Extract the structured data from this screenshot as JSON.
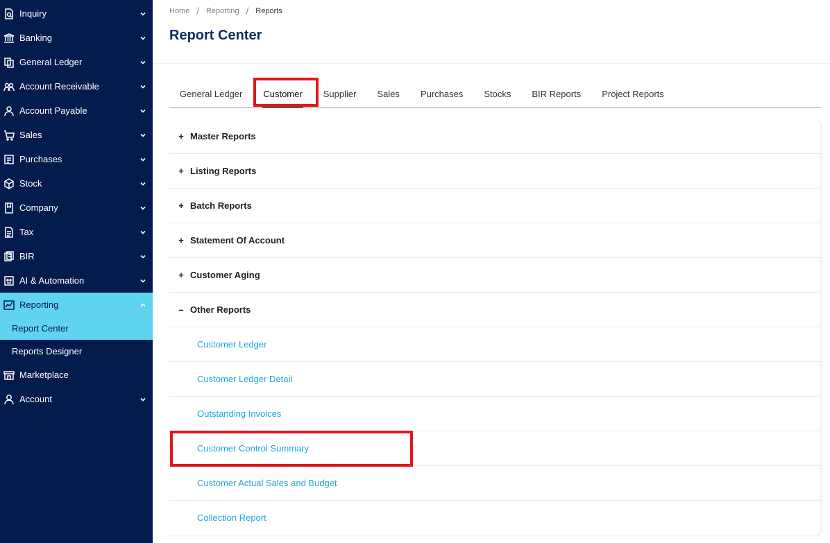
{
  "sidebar": {
    "items": [
      {
        "label": "Inquiry",
        "icon": "inquiry-icon"
      },
      {
        "label": "Banking",
        "icon": "bank-icon"
      },
      {
        "label": "General Ledger",
        "icon": "ledger-icon"
      },
      {
        "label": "Account Receivable",
        "icon": "receivable-icon"
      },
      {
        "label": "Account Payable",
        "icon": "payable-icon"
      },
      {
        "label": "Sales",
        "icon": "sales-icon"
      },
      {
        "label": "Purchases",
        "icon": "purchases-icon"
      },
      {
        "label": "Stock",
        "icon": "stock-icon"
      },
      {
        "label": "Company",
        "icon": "company-icon"
      },
      {
        "label": "Tax",
        "icon": "tax-icon"
      },
      {
        "label": "BIR",
        "icon": "bir-icon"
      },
      {
        "label": "AI & Automation",
        "icon": "ai-icon"
      },
      {
        "label": "Reporting",
        "icon": "reporting-icon"
      }
    ],
    "reporting_sub": [
      {
        "label": "Report Center"
      },
      {
        "label": "Reports Designer"
      }
    ],
    "after": [
      {
        "label": "Marketplace",
        "icon": "marketplace-icon"
      },
      {
        "label": "Account",
        "icon": "account-icon"
      }
    ]
  },
  "breadcrumb": [
    "Home",
    "Reporting",
    "Reports"
  ],
  "page_title": "Report Center",
  "tabs": [
    "General Ledger",
    "Customer",
    "Supplier",
    "Sales",
    "Purchases",
    "Stocks",
    "BIR Reports",
    "Project Reports"
  ],
  "active_tab": "Customer",
  "sections": [
    {
      "title": "Master Reports",
      "toggle": "+"
    },
    {
      "title": "Listing Reports",
      "toggle": "+"
    },
    {
      "title": "Batch Reports",
      "toggle": "+"
    },
    {
      "title": "Statement Of Account",
      "toggle": "+"
    },
    {
      "title": "Customer Aging",
      "toggle": "+"
    },
    {
      "title": "Other Reports",
      "toggle": "–"
    }
  ],
  "other_reports": [
    "Customer Ledger",
    "Customer Ledger Detail",
    "Outstanding Invoices",
    "Customer Control Summary",
    "Customer Actual Sales and Budget",
    "Collection Report"
  ],
  "colors": {
    "sidebar_bg": "#041b4d",
    "active_bg": "#5fd3f0",
    "title": "#0c2d64",
    "link": "#1ea7d9",
    "highlight": "#e3161b"
  }
}
